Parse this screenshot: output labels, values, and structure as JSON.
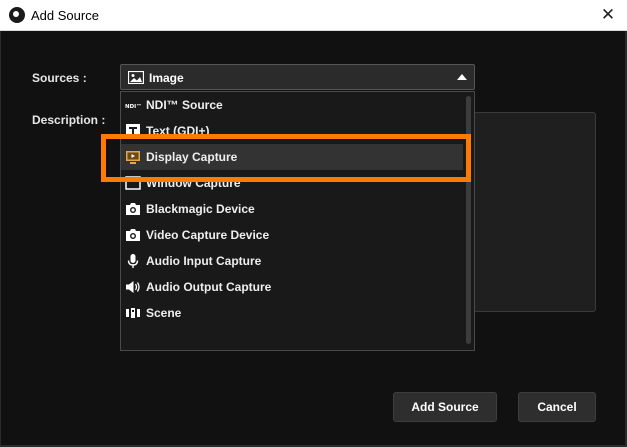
{
  "window": {
    "title": "Add Source"
  },
  "form": {
    "sources_label": "Sources :",
    "description_label": "Description :",
    "selected_source": "Image"
  },
  "dropdown": {
    "items": [
      {
        "label": "NDI™ Source",
        "icon": "ndi-icon"
      },
      {
        "label": "Text (GDI+)",
        "icon": "text-icon"
      },
      {
        "label": "Display Capture",
        "icon": "display-capture-icon",
        "selected": true
      },
      {
        "label": "Window Capture",
        "icon": "window-capture-icon"
      },
      {
        "label": "Blackmagic Device",
        "icon": "camera-icon"
      },
      {
        "label": "Video Capture Device",
        "icon": "camera-icon"
      },
      {
        "label": "Audio Input Capture",
        "icon": "microphone-icon"
      },
      {
        "label": "Audio Output Capture",
        "icon": "speaker-icon"
      },
      {
        "label": "Scene",
        "icon": "scene-icon"
      }
    ]
  },
  "buttons": {
    "add": "Add Source",
    "cancel": "Cancel"
  },
  "colors": {
    "highlight": "#ff7a00",
    "background": "#111111",
    "panel": "#191919"
  }
}
